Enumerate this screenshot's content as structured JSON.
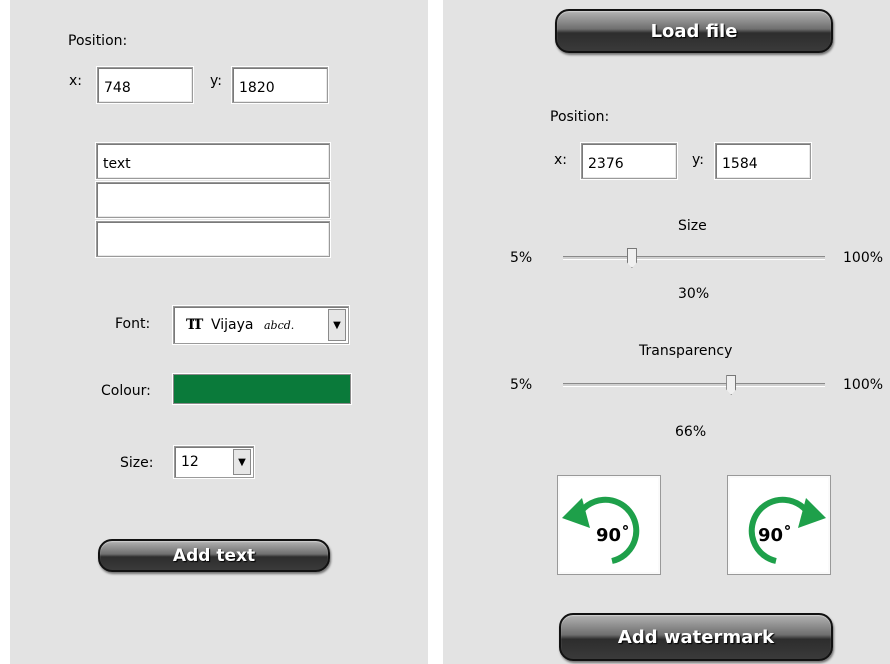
{
  "text_panel": {
    "position_label": "Position:",
    "x_label": "x:",
    "x_value": "748",
    "y_label": "y:",
    "y_value": "1820",
    "text_lines": [
      "text",
      "",
      ""
    ],
    "font_label": "Font:",
    "font_value": "Vijaya",
    "font_sample": "abcd.",
    "font_type_icon": "truetype-icon",
    "colour_label": "Colour:",
    "colour_value": "#0a7a3a",
    "size_label": "Size:",
    "size_value": "12",
    "add_text_button": "Add text"
  },
  "watermark_panel": {
    "load_file_button": "Load file",
    "position_label": "Position:",
    "x_label": "x:",
    "x_value": "2376",
    "y_label": "y:",
    "y_value": "1584",
    "size_slider": {
      "title": "Size",
      "min_label": "5%",
      "max_label": "100%",
      "value_label": "30%",
      "value": 30
    },
    "transparency_slider": {
      "title": "Transparency",
      "min_label": "5%",
      "max_label": "100%",
      "value_label": "66%",
      "value": 66
    },
    "rotate_left": {
      "icon": "rotate-counterclockwise-icon",
      "label": "90˚"
    },
    "rotate_right": {
      "icon": "rotate-clockwise-icon",
      "label": "90˚"
    },
    "add_watermark_button": "Add watermark"
  },
  "colors": {
    "panel_bg": "#e3e3e3",
    "rotate_arrow": "#1ea04a",
    "button_dark": "#2d2d2d"
  }
}
